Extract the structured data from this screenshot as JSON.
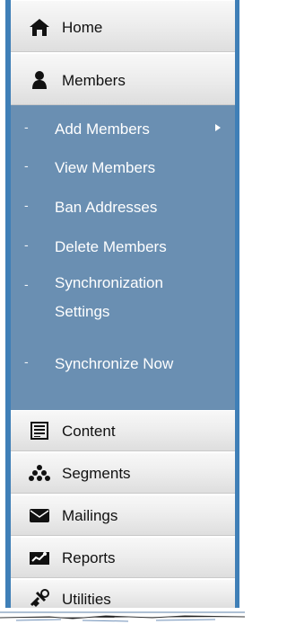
{
  "sidebar": {
    "nav": {
      "home_label": "Home",
      "members_label": "Members",
      "content_label": "Content",
      "segments_label": "Segments",
      "mailings_label": "Mailings",
      "reports_label": "Reports",
      "utilities_label": "Utilities"
    },
    "submenu": {
      "add_members": "Add Members",
      "view_members": "View Members",
      "ban_addresses": "Ban Addresses",
      "delete_members": "Delete Members",
      "sync_settings": "Synchronization Settings",
      "synchronize_now": "Synchronize Now"
    },
    "icons": {
      "home": "house-icon",
      "members": "person-icon",
      "content": "document-icon",
      "segments": "segments-icon",
      "mailings": "mail-icon",
      "reports": "reports-icon",
      "utilities": "tools-icon",
      "submenu_bullet": "dash-icon",
      "submenu_arrow": "chevron-right-icon"
    },
    "colors": {
      "sidebar_blue": "#3f7fb7",
      "submenu_blue": "#6a8fb2",
      "button_light": "#f8f8f8",
      "button_dark": "#dedede",
      "text_dark": "#111111",
      "text_light": "#ffffff"
    }
  }
}
